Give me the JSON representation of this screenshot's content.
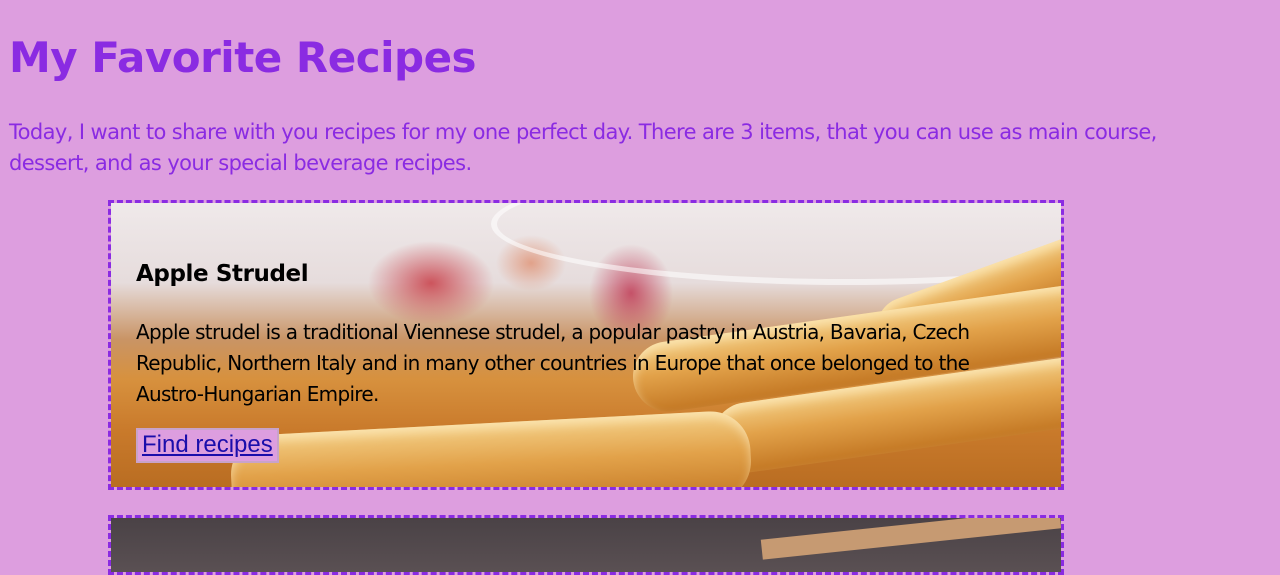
{
  "page": {
    "title": "My Favorite Recipes",
    "intro": "Today, I want to share with you recipes for my one perfect day. There are 3 items, that you can use as main course, dessert, and as your special beverage recipes."
  },
  "recipes": [
    {
      "title": "Apple Strudel",
      "description": "Apple strudel is a traditional Viennese strudel, a popular pastry in Austria, Bavaria, Czech Republic, Northern Italy and in many other countries in Europe that once belonged to the Austro-Hungarian Empire.",
      "link_label": "Find recipes",
      "image": "apple-strudel-photo"
    },
    {
      "image": "second-recipe-photo"
    }
  ],
  "colors": {
    "background": "#dd9edf",
    "accent": "#8a2be2",
    "link": "#1a0dab"
  }
}
